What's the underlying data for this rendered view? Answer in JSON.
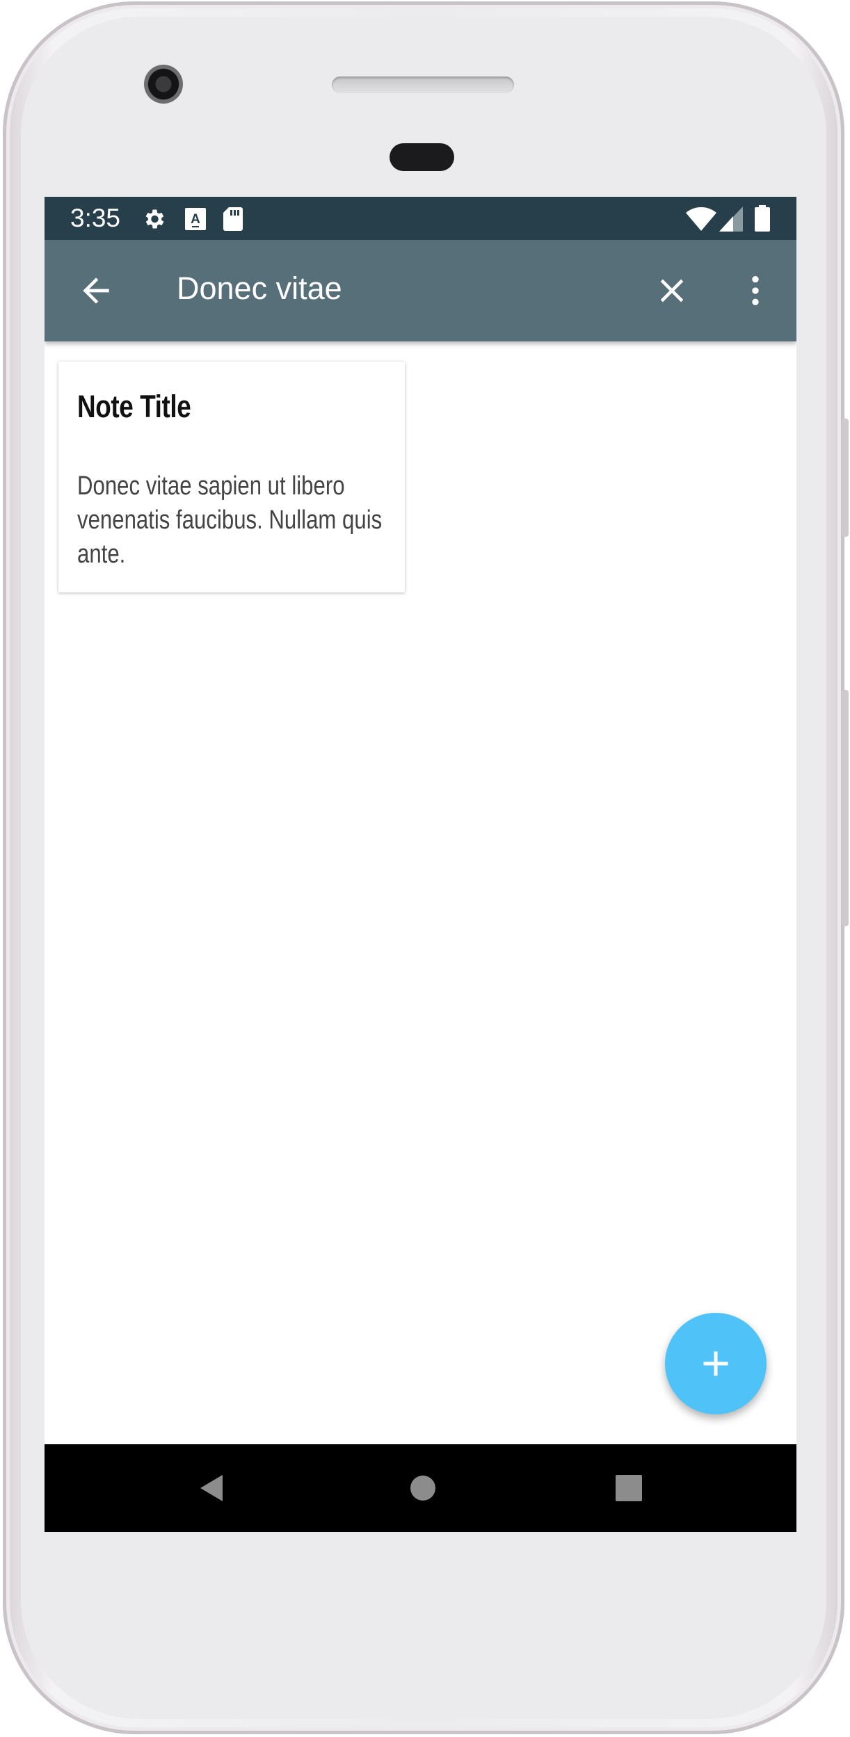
{
  "status_bar": {
    "time": "3:35",
    "left_icons": [
      "settings-icon",
      "font-icon",
      "sd-card-icon"
    ],
    "right_icons": [
      "wifi-icon",
      "cell-signal-icon",
      "battery-icon"
    ]
  },
  "toolbar": {
    "back_icon": "arrow-back-icon",
    "search_query": "Donec vitae",
    "clear_icon": "close-icon",
    "menu_icon": "more-vert-icon"
  },
  "notes": [
    {
      "title": "Note Title",
      "body": "Donec vitae sapien ut libero venenatis faucibus. Nullam quis ante."
    }
  ],
  "fab": {
    "icon": "add-icon"
  },
  "system_nav": {
    "icons": [
      "nav-back-icon",
      "nav-home-icon",
      "nav-recents-icon"
    ]
  },
  "colors": {
    "status_bar": "#263f4a",
    "app_bar": "#566f79",
    "fab": "#4fc3f7",
    "nav_bar": "#000000"
  }
}
